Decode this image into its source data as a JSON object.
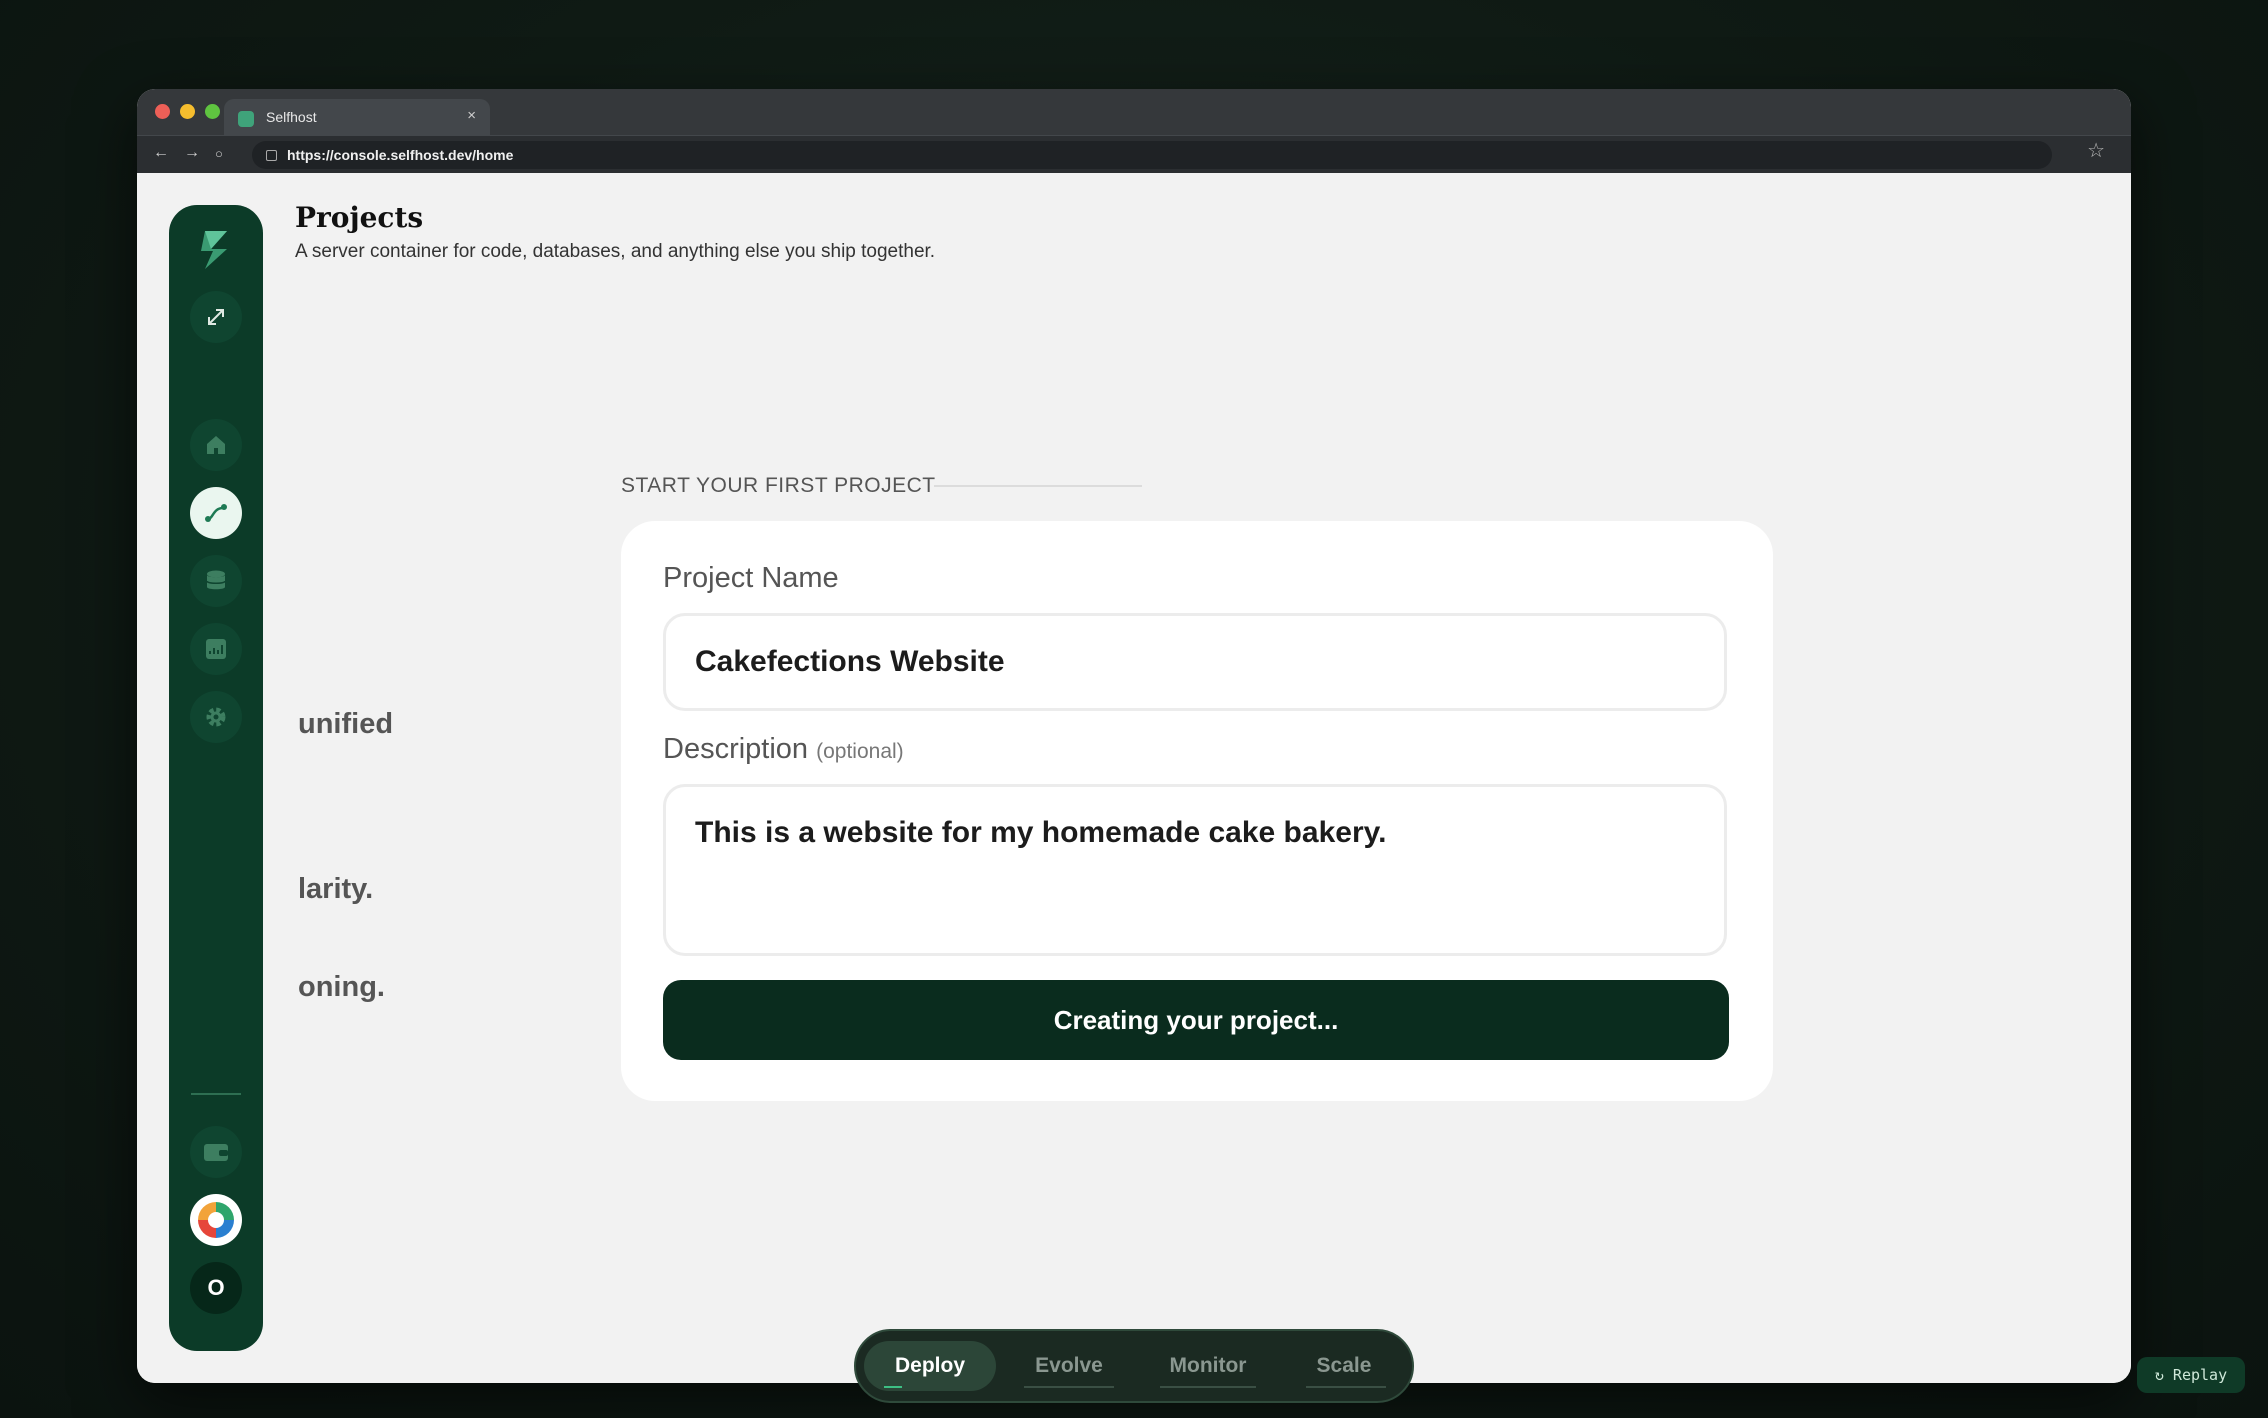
{
  "browser": {
    "tab_title": "Selfhost",
    "tab_close": "×",
    "url": "https://console.selfhost.dev/home",
    "back": "←",
    "forward": "→",
    "reload": "○",
    "star": "☆"
  },
  "sidebar": {
    "logo": "lightning-logo",
    "items": [
      {
        "icon": "expand-icon"
      },
      {
        "icon": "home-icon"
      },
      {
        "icon": "deploy-route-icon",
        "active": true
      },
      {
        "icon": "database-icon"
      },
      {
        "icon": "analytics-icon"
      },
      {
        "icon": "gear-icon"
      },
      {
        "icon": "wallet-icon"
      }
    ],
    "user_initial": "O"
  },
  "header": {
    "title": "Projects",
    "subtitle": "A server container for code, databases, and anything else you ship together."
  },
  "background_text": [
    "unified",
    "larity.",
    "oning."
  ],
  "form": {
    "section_label": "START YOUR FIRST PROJECT",
    "name_label": "Project Name",
    "name_value": "Cakefections Website",
    "description_label": "Description",
    "description_optional": "(optional)",
    "description_value": "This is a website for my homemade cake bakery.",
    "submit_label": "Creating your project..."
  },
  "bottom_nav": {
    "items": [
      {
        "label": "Deploy",
        "active": true
      },
      {
        "label": "Evolve"
      },
      {
        "label": "Monitor"
      },
      {
        "label": "Scale"
      }
    ]
  },
  "replay_label": "↻ Replay",
  "colors": {
    "brand_dark": "#0c3b28",
    "button": "#0a2c1e",
    "accent": "#3dbf84"
  }
}
